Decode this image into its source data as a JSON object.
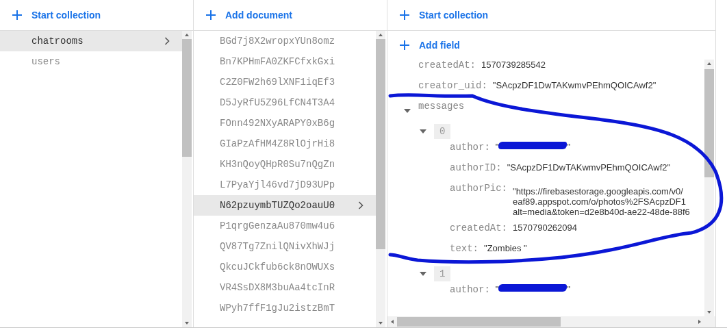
{
  "collections": {
    "action": "Start collection",
    "items": [
      {
        "label": "chatrooms",
        "selected": true
      },
      {
        "label": "users",
        "selected": false
      }
    ]
  },
  "documents": {
    "action": "Add document",
    "items": [
      {
        "label": "BGd7j8X2wropxYUn8omz",
        "selected": false
      },
      {
        "label": "Bn7KPHmFA0ZKFCfxkGxi",
        "selected": false
      },
      {
        "label": "C2Z0FW2h69lXNF1iqEf3",
        "selected": false
      },
      {
        "label": "D5JyRfU5Z96LfCN4T3A4",
        "selected": false
      },
      {
        "label": "FOnn492NXyARAPY0xB6g",
        "selected": false
      },
      {
        "label": "GIaPzAfHM4Z8RlOjrHi8",
        "selected": false
      },
      {
        "label": "KH3nQoyQHpR0Su7nQgZn",
        "selected": false
      },
      {
        "label": "L7PyaYjl46vd7jD93UPp",
        "selected": false
      },
      {
        "label": "N62pzuymbTUZQo2oauU0",
        "selected": true
      },
      {
        "label": "P1qrgGenzaAu870mw4u6",
        "selected": false
      },
      {
        "label": "QV87Tg7ZnilQNivXhWJj",
        "selected": false
      },
      {
        "label": "QkcuJCkfub6ck8nOWUXs",
        "selected": false
      },
      {
        "label": "VR4SsDX8M3buAa4tcInR",
        "selected": false
      },
      {
        "label": "WPyh7ffF1gJu2istzBmT",
        "selected": false
      }
    ]
  },
  "document": {
    "collection_action": "Start collection",
    "field_action": "Add field",
    "fields": [
      {
        "kind": "value",
        "key": "createdAt:",
        "value": "1570739285542"
      },
      {
        "kind": "value",
        "key": "creator_uid:",
        "value": "\"SAcpzDF1DwTAKwmvPEhmQOICAwf2\""
      },
      {
        "kind": "group",
        "key": "messages",
        "expanded": true,
        "children": [
          {
            "kind": "index",
            "key": "0",
            "expanded": true,
            "children": [
              {
                "kind": "redacted",
                "key": "author:",
                "value_start": "\"",
                "value_end": "\""
              },
              {
                "kind": "value",
                "key": "authorID:",
                "value": "\"SAcpzDF1DwTAKwmvPEhmQOICAwf2\""
              },
              {
                "kind": "lines",
                "key": "authorPic:",
                "lines": [
                  "\"https://firebasestorage.googleapis.com/v0/",
                  "eaf89.appspot.com/o/photos%2FSAcpzDF1",
                  "alt=media&token=d2e8b40d-ae22-48de-88f6"
                ]
              },
              {
                "kind": "value",
                "key": "createdAt:",
                "value": "1570790262094"
              },
              {
                "kind": "value",
                "key": "text:",
                "value": "\"Zombies \""
              }
            ]
          },
          {
            "kind": "index",
            "key": "1",
            "expanded": true,
            "children": [
              {
                "kind": "redacted",
                "key": "author:",
                "value_start": "\"",
                "value_end": "\""
              }
            ]
          }
        ]
      }
    ]
  }
}
